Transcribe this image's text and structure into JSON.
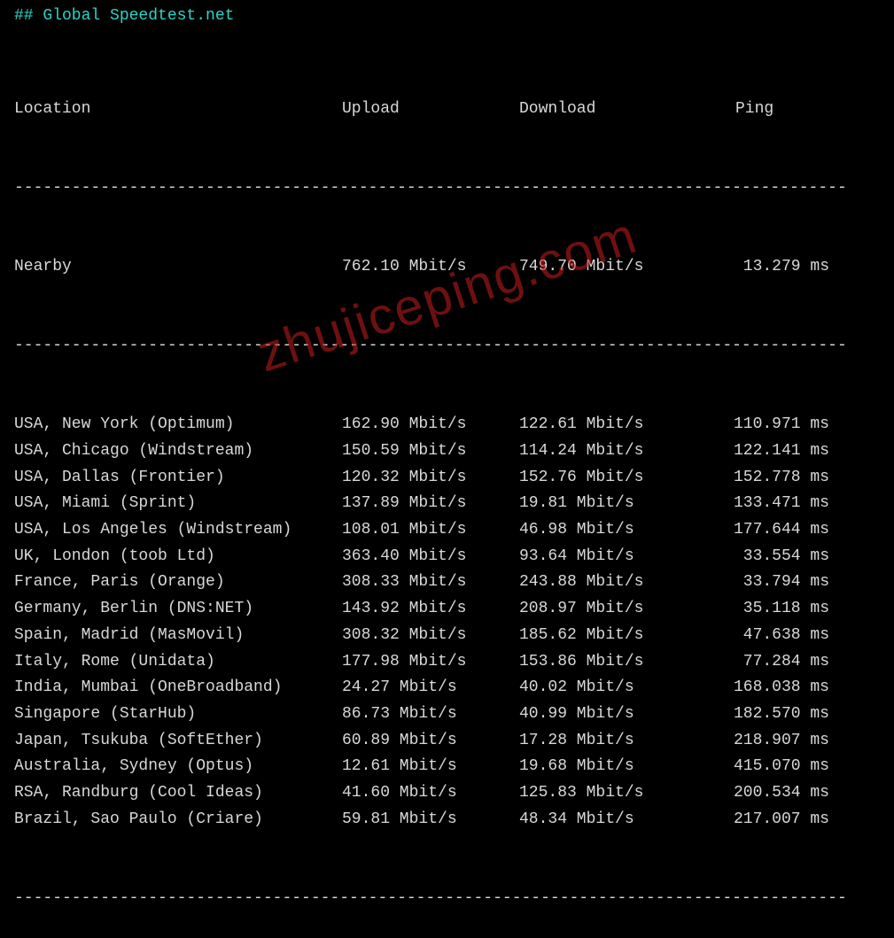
{
  "title": "## Global Speedtest.net",
  "headers": {
    "location": "Location",
    "upload": "Upload",
    "download": "Download",
    "ping": "Ping"
  },
  "dashes": "---------------------------------------------------------------------------------------",
  "nearby": {
    "location": "Nearby",
    "upload": "762.10 Mbit/s",
    "download": "749.70 Mbit/s",
    "ping": "13.279 ms"
  },
  "rows": [
    {
      "location": "USA, New York (Optimum)",
      "upload": "162.90 Mbit/s",
      "download": "122.61 Mbit/s",
      "ping": "110.971 ms"
    },
    {
      "location": "USA, Chicago (Windstream)",
      "upload": "150.59 Mbit/s",
      "download": "114.24 Mbit/s",
      "ping": "122.141 ms"
    },
    {
      "location": "USA, Dallas (Frontier)",
      "upload": "120.32 Mbit/s",
      "download": "152.76 Mbit/s",
      "ping": "152.778 ms"
    },
    {
      "location": "USA, Miami (Sprint)",
      "upload": "137.89 Mbit/s",
      "download": "19.81 Mbit/s",
      "ping": "133.471 ms"
    },
    {
      "location": "USA, Los Angeles (Windstream)",
      "upload": "108.01 Mbit/s",
      "download": "46.98 Mbit/s",
      "ping": "177.644 ms"
    },
    {
      "location": "UK, London (toob Ltd)",
      "upload": "363.40 Mbit/s",
      "download": "93.64 Mbit/s",
      "ping": "33.554 ms"
    },
    {
      "location": "France, Paris (Orange)",
      "upload": "308.33 Mbit/s",
      "download": "243.88 Mbit/s",
      "ping": "33.794 ms"
    },
    {
      "location": "Germany, Berlin (DNS:NET)",
      "upload": "143.92 Mbit/s",
      "download": "208.97 Mbit/s",
      "ping": "35.118 ms"
    },
    {
      "location": "Spain, Madrid (MasMovil)",
      "upload": "308.32 Mbit/s",
      "download": "185.62 Mbit/s",
      "ping": "47.638 ms"
    },
    {
      "location": "Italy, Rome (Unidata)",
      "upload": "177.98 Mbit/s",
      "download": "153.86 Mbit/s",
      "ping": "77.284 ms"
    },
    {
      "location": "India, Mumbai (OneBroadband)",
      "upload": "24.27 Mbit/s",
      "download": "40.02 Mbit/s",
      "ping": "168.038 ms"
    },
    {
      "location": "Singapore (StarHub)",
      "upload": "86.73 Mbit/s",
      "download": "40.99 Mbit/s",
      "ping": "182.570 ms"
    },
    {
      "location": "Japan, Tsukuba (SoftEther)",
      "upload": "60.89 Mbit/s",
      "download": "17.28 Mbit/s",
      "ping": "218.907 ms"
    },
    {
      "location": "Australia, Sydney (Optus)",
      "upload": "12.61 Mbit/s",
      "download": "19.68 Mbit/s",
      "ping": "415.070 ms"
    },
    {
      "location": "RSA, Randburg (Cool Ideas)",
      "upload": "41.60 Mbit/s",
      "download": "125.83 Mbit/s",
      "ping": "200.534 ms"
    },
    {
      "location": "Brazil, Sao Paulo (Criare)",
      "upload": "59.81 Mbit/s",
      "download": "48.34 Mbit/s",
      "ping": "217.007 ms"
    }
  ],
  "watermark": "zhujiceping.com"
}
